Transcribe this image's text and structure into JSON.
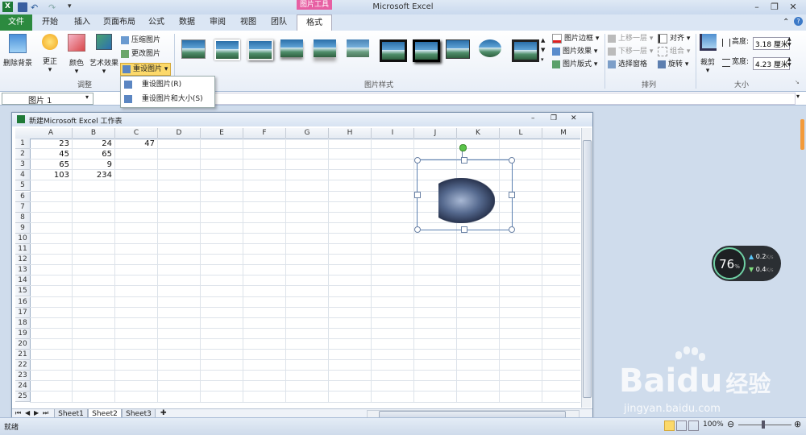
{
  "app": {
    "title": "Microsoft Excel",
    "context_tab_group": "图片工具"
  },
  "window_controls": {
    "minimize": "–",
    "restore": "❐",
    "close": "✕",
    "help": "?"
  },
  "tabs": [
    {
      "label": "文件"
    },
    {
      "label": "开始"
    },
    {
      "label": "插入"
    },
    {
      "label": "页面布局"
    },
    {
      "label": "公式"
    },
    {
      "label": "数据"
    },
    {
      "label": "审阅"
    },
    {
      "label": "视图"
    },
    {
      "label": "团队"
    },
    {
      "label": "格式"
    }
  ],
  "ribbon": {
    "adjust": {
      "remove_bg": "删除背景",
      "correct": "更正",
      "color": "颜色",
      "artistic": "艺术效果",
      "compress": "压缩图片",
      "change": "更改图片",
      "reset": "重设图片",
      "group_label": "调整"
    },
    "styles": {
      "group_label": "图片样式",
      "border": "图片边框",
      "effects": "图片效果",
      "layout": "图片版式"
    },
    "arrange": {
      "group_label": "排列",
      "bring_forward": "上移一层",
      "send_backward": "下移一层",
      "selection_pane": "选择窗格",
      "align": "对齐",
      "group": "组合",
      "rotate": "旋转"
    },
    "size": {
      "group_label": "大小",
      "crop": "裁剪",
      "height_label": "高度:",
      "height": "3.18 厘米",
      "width_label": "宽度:",
      "width": "4.23 厘米"
    }
  },
  "dropdown": {
    "item1": "重设图片(R)",
    "item2": "重设图片和大小(S)"
  },
  "formula_bar": {
    "name_box": "图片 1"
  },
  "workbook": {
    "title": "新建Microsoft Excel 工作表",
    "columns": [
      "A",
      "B",
      "C",
      "D",
      "E",
      "F",
      "G",
      "H",
      "I",
      "J",
      "K",
      "L",
      "M"
    ],
    "rows": [
      "1",
      "2",
      "3",
      "4",
      "5",
      "6",
      "7",
      "8",
      "9",
      "10",
      "11",
      "12",
      "13",
      "14",
      "15",
      "16",
      "17",
      "18",
      "19",
      "20",
      "21",
      "22",
      "23",
      "24",
      "25"
    ],
    "cells": {
      "A1": "23",
      "B1": "24",
      "C1": "47",
      "A2": "45",
      "B2": "65",
      "A3": "65",
      "B3": "9",
      "A4": "103",
      "B4": "234"
    },
    "sheets": [
      "Sheet1",
      "Sheet2",
      "Sheet3"
    ]
  },
  "status": {
    "ready": "就绪",
    "zoom": "100%"
  },
  "widget": {
    "percent": "76",
    "pct_sign": "%",
    "up": "0.2",
    "up_unit": "K/s",
    "down": "0.4",
    "down_unit": "K/s"
  },
  "watermark": {
    "brand_a": "Bai",
    "brand_b": "du",
    "brand_cn": "经验",
    "url": "jingyan.baidu.com"
  },
  "colors": {
    "file_tab": "#2c8a3f",
    "context_tab": "#e75fa3",
    "highlight": "#fcd96a"
  }
}
